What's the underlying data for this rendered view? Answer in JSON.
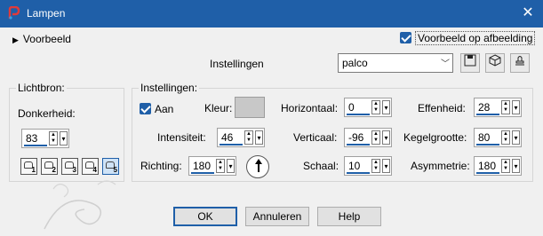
{
  "window": {
    "title": "Lampen",
    "close_glyph": "✕"
  },
  "preview_toggle": {
    "label": "Voorbeeld"
  },
  "preview_on_image": {
    "label": "Voorbeeld op afbeelding",
    "checked": true
  },
  "settings": {
    "label": "Instellingen",
    "preset_value": "palco"
  },
  "lightsource": {
    "title": "Lichtbron:",
    "darkness_label": "Donkerheid:",
    "darkness_value": "83",
    "lights": [
      "1",
      "2",
      "3",
      "4",
      "5"
    ],
    "selected_light": "5"
  },
  "instellingen": {
    "title": "Instellingen:",
    "on_label": "Aan",
    "color_label": "Kleur:",
    "horizontal_label": "Horizontaal:",
    "horizontal_value": "0",
    "smoothness_label": "Effenheid:",
    "smoothness_value": "28",
    "intensity_label": "Intensiteit:",
    "intensity_value": "46",
    "vertical_label": "Verticaal:",
    "vertical_value": "-96",
    "cone_label": "Kegelgrootte:",
    "cone_value": "80",
    "direction_label": "Richting:",
    "direction_value": "180",
    "scale_label": "Schaal:",
    "scale_value": "10",
    "asymmetry_label": "Asymmetrie:",
    "asymmetry_value": "180"
  },
  "buttons": {
    "ok": "OK",
    "cancel": "Annuleren",
    "help": "Help"
  },
  "colors": {
    "title_bar": "#1f5fa8",
    "accent": "#1f5fa8",
    "swatch": "#c8c8c8"
  }
}
